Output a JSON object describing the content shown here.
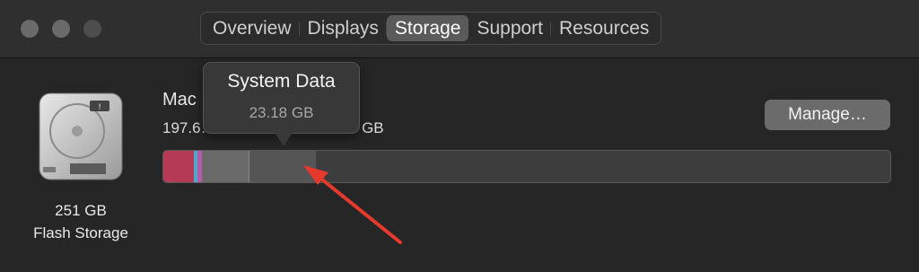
{
  "tabs": [
    {
      "label": "Overview"
    },
    {
      "label": "Displays"
    },
    {
      "label": "Storage"
    },
    {
      "label": "Support"
    },
    {
      "label": "Resources"
    }
  ],
  "active_tab": "Storage",
  "disk": {
    "capacity": "251 GB",
    "type": "Flash Storage"
  },
  "volume": {
    "name": "Mac",
    "summary": "197.6… GB a… … of 250.69 GB"
  },
  "manage_label": "Manage…",
  "tooltip": {
    "title": "System Data",
    "size": "23.18 GB"
  },
  "icons": {
    "disk": "hard-drive-icon",
    "arrow": "red-annotation-arrow"
  },
  "colors": {
    "accent_red": "#e5392d",
    "segment_pink": "#b43a55",
    "segment_blue": "#4fa7c9",
    "segment_purple": "#b35aa8"
  }
}
